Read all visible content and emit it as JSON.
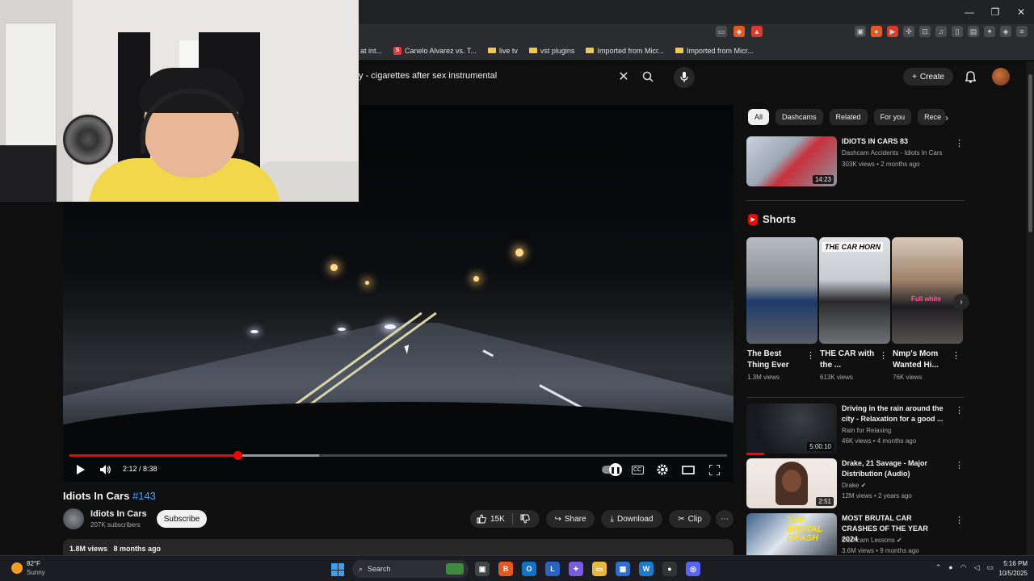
{
  "browser": {
    "window_controls": [
      "—",
      "❐",
      "✕"
    ],
    "bookmarks": [
      {
        "label": "at int...",
        "type": "plain"
      },
      {
        "label": "Canelo Alvarez vs. T...",
        "type": "site"
      },
      {
        "label": "live tv",
        "type": "folder"
      },
      {
        "label": "vst plugins",
        "type": "folder"
      },
      {
        "label": "Imported from Micr...",
        "type": "folder"
      },
      {
        "label": "Imported from Micr...",
        "type": "folder"
      }
    ],
    "shields_badge": "",
    "notif_badge": ""
  },
  "header": {
    "search_query": "y - cigarettes after sex instrumental",
    "clear_label": "✕",
    "create_label": "Create"
  },
  "player": {
    "time_display": "2:12 / 8:38",
    "progress_played": 0.255,
    "progress_buffered": 0.38,
    "cc_label": "CC"
  },
  "video": {
    "title": "Idiots In Cars",
    "title_hashtag": "#143",
    "channel_name": "Idiots In Cars",
    "channel_subs": "207K subscribers",
    "subscribe_label": "Subscribe",
    "likes": "15K",
    "share_label": "Share",
    "download_label": "Download",
    "clip_label": "Clip",
    "views": "1.8M views",
    "age": "8 months ago"
  },
  "chips": [
    "All",
    "Dashcams",
    "Related",
    "For you",
    "Rece"
  ],
  "recommendations": [
    {
      "title": "IDIOTS IN CARS 83",
      "channel": "Dashcam Accidents - Idiots In Cars",
      "meta": "303K views • 2 months ago",
      "duration": "14:23",
      "thumb_color": "#b8c6d3"
    },
    {
      "title": "Driving in the rain around the city - Relaxation for a good ...",
      "channel": "Rain for Relaxing",
      "meta": "46K views • 4 months ago",
      "duration": "5:00:10",
      "thumb_color": "#1c1f24"
    },
    {
      "title": "Drake, 21 Savage - Major Distribution (Audio)",
      "channel": "Drake",
      "meta": "12M views • 2 years ago",
      "duration": "2:51",
      "thumb_color": "#e9e3df"
    },
    {
      "title": "MOST BRUTAL CAR CRASHES OF THE YEAR 2024",
      "channel": "Dashcam Lessons",
      "meta": "3.6M views • 9 months ago",
      "duration": "",
      "thumb_color": "#3a5f8a"
    }
  ],
  "shorts": {
    "heading": "Shorts",
    "items": [
      {
        "title": "The Best Thing Ever",
        "views": "1.3M views"
      },
      {
        "title": "THE CAR with the ...",
        "views": "613K views",
        "overlay": "THE CAR HORN"
      },
      {
        "title": "Nmp's Mom Wanted Hi...",
        "views": "76K views",
        "overlay": "Full white"
      }
    ]
  },
  "taskbar": {
    "temperature": "82°F",
    "weather": "Sunny",
    "search_label": "Search",
    "time": "5:16 PM",
    "date": "10/5/2025"
  }
}
